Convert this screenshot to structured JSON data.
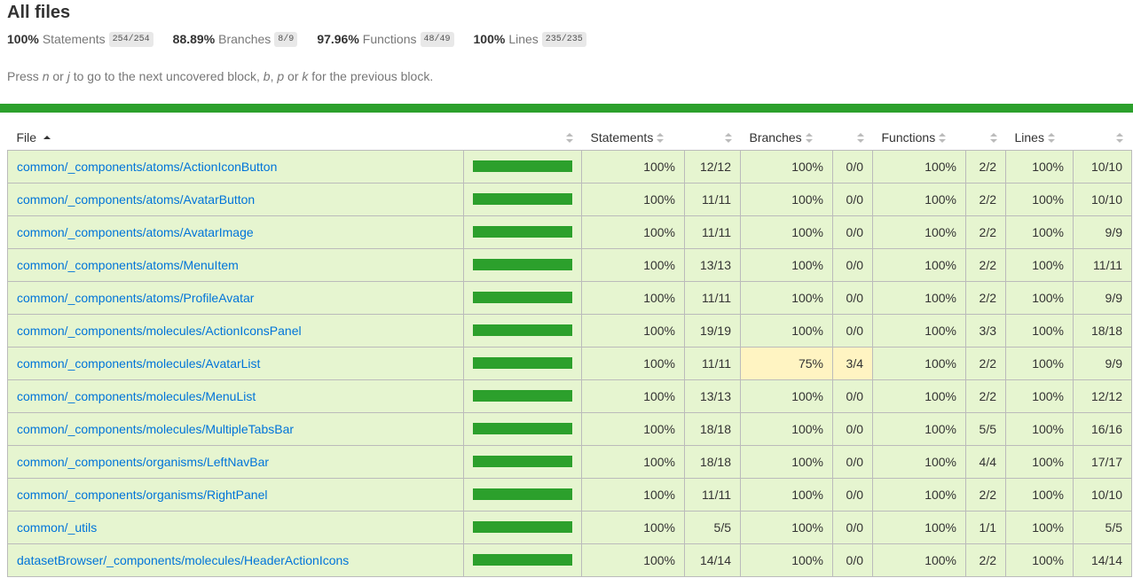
{
  "page": {
    "title": "All files",
    "summary": [
      {
        "pct": "100%",
        "label": "Statements",
        "fraction": "254/254"
      },
      {
        "pct": "88.89%",
        "label": "Branches",
        "fraction": "8/9"
      },
      {
        "pct": "97.96%",
        "label": "Functions",
        "fraction": "48/49"
      },
      {
        "pct": "100%",
        "label": "Lines",
        "fraction": "235/235"
      }
    ],
    "help": {
      "t1": "Press ",
      "k1": "n",
      "t2": " or ",
      "k2": "j",
      "t3": " to go to the next uncovered block, ",
      "k3": "b",
      "t4": ", ",
      "k4": "p",
      "t5": " or ",
      "k5": "k",
      "t6": " for the previous block."
    },
    "status_color": "#2ca02c"
  },
  "table": {
    "headers": {
      "file": "File",
      "statements": "Statements",
      "branches": "Branches",
      "functions": "Functions",
      "lines": "Lines"
    },
    "sort": {
      "column": "File",
      "direction": "ascending"
    },
    "rows": [
      {
        "file": "common/_components/atoms/ActionIconButton",
        "coverage": 1.0,
        "st_pct": "100%",
        "st_abs": "12/12",
        "br_pct": "100%",
        "br_abs": "0/0",
        "br_level": "high",
        "fn_pct": "100%",
        "fn_abs": "2/2",
        "ln_pct": "100%",
        "ln_abs": "10/10"
      },
      {
        "file": "common/_components/atoms/AvatarButton",
        "coverage": 1.0,
        "st_pct": "100%",
        "st_abs": "11/11",
        "br_pct": "100%",
        "br_abs": "0/0",
        "br_level": "high",
        "fn_pct": "100%",
        "fn_abs": "2/2",
        "ln_pct": "100%",
        "ln_abs": "10/10"
      },
      {
        "file": "common/_components/atoms/AvatarImage",
        "coverage": 1.0,
        "st_pct": "100%",
        "st_abs": "11/11",
        "br_pct": "100%",
        "br_abs": "0/0",
        "br_level": "high",
        "fn_pct": "100%",
        "fn_abs": "2/2",
        "ln_pct": "100%",
        "ln_abs": "9/9"
      },
      {
        "file": "common/_components/atoms/MenuItem",
        "coverage": 1.0,
        "st_pct": "100%",
        "st_abs": "13/13",
        "br_pct": "100%",
        "br_abs": "0/0",
        "br_level": "high",
        "fn_pct": "100%",
        "fn_abs": "2/2",
        "ln_pct": "100%",
        "ln_abs": "11/11"
      },
      {
        "file": "common/_components/atoms/ProfileAvatar",
        "coverage": 1.0,
        "st_pct": "100%",
        "st_abs": "11/11",
        "br_pct": "100%",
        "br_abs": "0/0",
        "br_level": "high",
        "fn_pct": "100%",
        "fn_abs": "2/2",
        "ln_pct": "100%",
        "ln_abs": "9/9"
      },
      {
        "file": "common/_components/molecules/ActionIconsPanel",
        "coverage": 1.0,
        "st_pct": "100%",
        "st_abs": "19/19",
        "br_pct": "100%",
        "br_abs": "0/0",
        "br_level": "high",
        "fn_pct": "100%",
        "fn_abs": "3/3",
        "ln_pct": "100%",
        "ln_abs": "18/18"
      },
      {
        "file": "common/_components/molecules/AvatarList",
        "coverage": 1.0,
        "st_pct": "100%",
        "st_abs": "11/11",
        "br_pct": "75%",
        "br_abs": "3/4",
        "br_level": "medium",
        "fn_pct": "100%",
        "fn_abs": "2/2",
        "ln_pct": "100%",
        "ln_abs": "9/9"
      },
      {
        "file": "common/_components/molecules/MenuList",
        "coverage": 1.0,
        "st_pct": "100%",
        "st_abs": "13/13",
        "br_pct": "100%",
        "br_abs": "0/0",
        "br_level": "high",
        "fn_pct": "100%",
        "fn_abs": "2/2",
        "ln_pct": "100%",
        "ln_abs": "12/12"
      },
      {
        "file": "common/_components/molecules/MultipleTabsBar",
        "coverage": 1.0,
        "st_pct": "100%",
        "st_abs": "18/18",
        "br_pct": "100%",
        "br_abs": "0/0",
        "br_level": "high",
        "fn_pct": "100%",
        "fn_abs": "5/5",
        "ln_pct": "100%",
        "ln_abs": "16/16"
      },
      {
        "file": "common/_components/organisms/LeftNavBar",
        "coverage": 1.0,
        "st_pct": "100%",
        "st_abs": "18/18",
        "br_pct": "100%",
        "br_abs": "0/0",
        "br_level": "high",
        "fn_pct": "100%",
        "fn_abs": "4/4",
        "ln_pct": "100%",
        "ln_abs": "17/17"
      },
      {
        "file": "common/_components/organisms/RightPanel",
        "coverage": 1.0,
        "st_pct": "100%",
        "st_abs": "11/11",
        "br_pct": "100%",
        "br_abs": "0/0",
        "br_level": "high",
        "fn_pct": "100%",
        "fn_abs": "2/2",
        "ln_pct": "100%",
        "ln_abs": "10/10"
      },
      {
        "file": "common/_utils",
        "coverage": 1.0,
        "st_pct": "100%",
        "st_abs": "5/5",
        "br_pct": "100%",
        "br_abs": "0/0",
        "br_level": "high",
        "fn_pct": "100%",
        "fn_abs": "1/1",
        "ln_pct": "100%",
        "ln_abs": "5/5"
      },
      {
        "file": "datasetBrowser/_components/molecules/HeaderActionIcons",
        "coverage": 1.0,
        "st_pct": "100%",
        "st_abs": "14/14",
        "br_pct": "100%",
        "br_abs": "0/0",
        "br_level": "high",
        "fn_pct": "100%",
        "fn_abs": "2/2",
        "ln_pct": "100%",
        "ln_abs": "14/14"
      }
    ]
  }
}
